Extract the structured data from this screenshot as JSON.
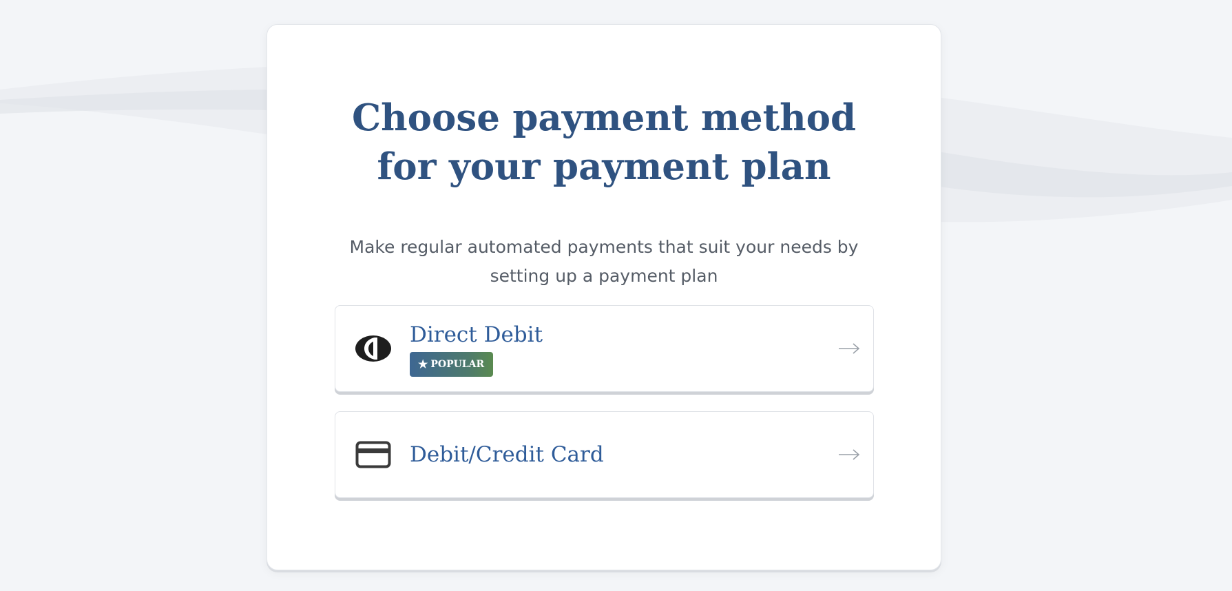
{
  "page": {
    "title": "Choose payment method for your payment plan",
    "subtitle": "Make regular automated payments that suit your needs by setting up a payment plan"
  },
  "options": [
    {
      "label": "Direct Debit",
      "icon": "direct-debit-icon",
      "badge": "POPULAR",
      "badge_icon": "star-icon"
    },
    {
      "label": "Debit/Credit Card",
      "icon": "credit-card-icon"
    }
  ],
  "colors": {
    "heading": "#2f5280",
    "option_label": "#2f5c99",
    "badge_gradient_start": "#3e6792",
    "badge_gradient_end": "#5a8a50",
    "background": "#f3f5f8"
  }
}
